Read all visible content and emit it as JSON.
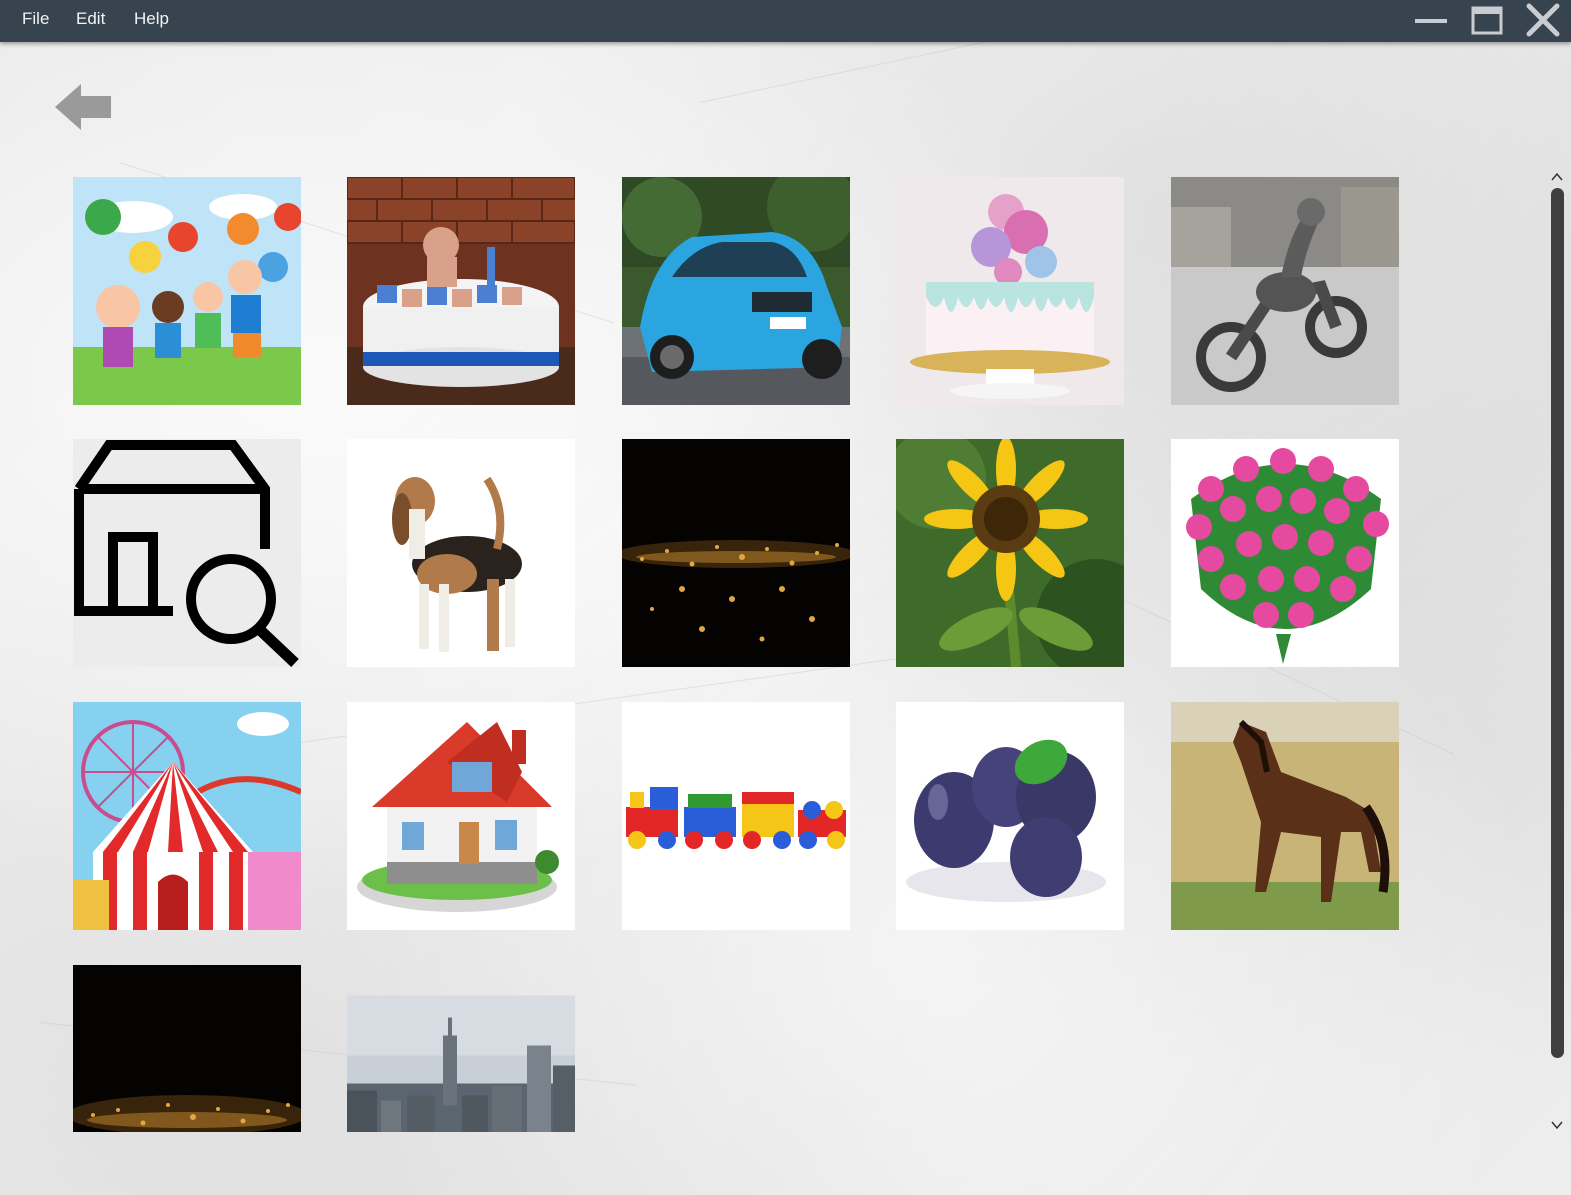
{
  "menu": {
    "file": "File",
    "edit": "Edit",
    "help": "Help"
  },
  "window_controls": {
    "minimize_icon": "minimize-icon",
    "maximize_icon": "maximize-icon",
    "close_icon": "close-icon"
  },
  "navigation": {
    "back_icon": "back-arrow-icon"
  },
  "gallery": {
    "images": [
      {
        "icon": "children-balloons-image"
      },
      {
        "icon": "birthday-cake-image"
      },
      {
        "icon": "blue-car-image"
      },
      {
        "icon": "drip-cake-image"
      },
      {
        "icon": "motorcycle-statue-image"
      },
      {
        "icon": "store-search-icon"
      },
      {
        "icon": "beagle-dog-image"
      },
      {
        "icon": "golden-lights-image"
      },
      {
        "icon": "sunflower-image"
      },
      {
        "icon": "pink-roses-image"
      },
      {
        "icon": "carnival-circus-image"
      },
      {
        "icon": "house-image"
      },
      {
        "icon": "toy-train-image"
      },
      {
        "icon": "plums-image"
      },
      {
        "icon": "horse-image"
      },
      {
        "icon": "golden-lights-image"
      },
      {
        "icon": "city-skyline-image"
      }
    ]
  },
  "colors": {
    "titlebar": "#37434e",
    "menu_text": "#f1f3f5",
    "background": "#ececec",
    "scrollbar_thumb": "#3f3f3f"
  }
}
